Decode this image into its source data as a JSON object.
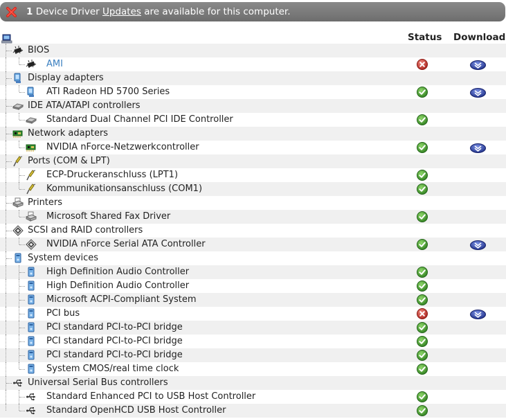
{
  "banner": {
    "count": "1",
    "pre_text": "Device Driver",
    "link_text": "Updates",
    "post_text": "are available for this computer."
  },
  "columns": {
    "status": "Status",
    "download": "Download"
  },
  "tree": [
    {
      "label": "BIOS",
      "level": 0,
      "icon": "chip-icon",
      "status": null,
      "download": false
    },
    {
      "label": "AMI",
      "level": 1,
      "icon": "chip-icon",
      "status": "error",
      "download": true,
      "link": true
    },
    {
      "label": "Display adapters",
      "level": 0,
      "icon": "monitor-icon",
      "status": null,
      "download": false
    },
    {
      "label": "ATI Radeon HD 5700 Series",
      "level": 1,
      "icon": "monitor-icon",
      "status": "ok",
      "download": true
    },
    {
      "label": "IDE ATA/ATAPI controllers",
      "level": 0,
      "icon": "drive-icon",
      "status": null,
      "download": false
    },
    {
      "label": "Standard Dual Channel PCI IDE Controller",
      "level": 1,
      "icon": "drive-icon",
      "status": "ok",
      "download": false
    },
    {
      "label": "Network adapters",
      "level": 0,
      "icon": "network-card-icon",
      "status": null,
      "download": false
    },
    {
      "label": "NVIDIA nForce-Netzwerkcontroller",
      "level": 1,
      "icon": "network-card-icon",
      "status": "ok",
      "download": true
    },
    {
      "label": "Ports (COM & LPT)",
      "level": 0,
      "icon": "port-icon",
      "status": null,
      "download": false
    },
    {
      "label": "ECP-Druckeranschluss (LPT1)",
      "level": 1,
      "icon": "port-icon",
      "status": "ok",
      "download": false
    },
    {
      "label": "Kommunikationsanschluss (COM1)",
      "level": 1,
      "icon": "port-icon",
      "status": "ok",
      "download": false
    },
    {
      "label": "Printers",
      "level": 0,
      "icon": "printer-icon",
      "status": null,
      "download": false
    },
    {
      "label": "Microsoft Shared Fax Driver",
      "level": 1,
      "icon": "printer-icon",
      "status": "ok",
      "download": false
    },
    {
      "label": "SCSI and RAID controllers",
      "level": 0,
      "icon": "scsi-icon",
      "status": null,
      "download": false
    },
    {
      "label": "NVIDIA nForce Serial ATA Controller",
      "level": 1,
      "icon": "scsi-icon",
      "status": "ok",
      "download": true
    },
    {
      "label": "System devices",
      "level": 0,
      "icon": "system-device-icon",
      "status": null,
      "download": false
    },
    {
      "label": "High Definition Audio Controller",
      "level": 1,
      "icon": "system-device-icon",
      "status": "ok",
      "download": false
    },
    {
      "label": "High Definition Audio Controller",
      "level": 1,
      "icon": "system-device-icon",
      "status": "ok",
      "download": false
    },
    {
      "label": "Microsoft ACPI-Compliant System",
      "level": 1,
      "icon": "system-device-icon",
      "status": "ok",
      "download": false
    },
    {
      "label": "PCI bus",
      "level": 1,
      "icon": "system-device-icon",
      "status": "error",
      "download": true
    },
    {
      "label": "PCI standard PCI-to-PCI bridge",
      "level": 1,
      "icon": "system-device-icon",
      "status": "ok",
      "download": false
    },
    {
      "label": "PCI standard PCI-to-PCI bridge",
      "level": 1,
      "icon": "system-device-icon",
      "status": "ok",
      "download": false
    },
    {
      "label": "PCI standard PCI-to-PCI bridge",
      "level": 1,
      "icon": "system-device-icon",
      "status": "ok",
      "download": false
    },
    {
      "label": "System CMOS/real time clock",
      "level": 1,
      "icon": "system-device-icon",
      "status": "ok",
      "download": false
    },
    {
      "label": "Universal Serial Bus controllers",
      "level": 0,
      "icon": "usb-icon",
      "status": null,
      "download": false
    },
    {
      "label": "Standard Enhanced PCI to USB Host Controller",
      "level": 1,
      "icon": "usb-icon",
      "status": "ok",
      "download": false
    },
    {
      "label": "Standard OpenHCD USB Host Controller",
      "level": 1,
      "icon": "usb-icon",
      "status": "ok",
      "download": false
    }
  ],
  "colors": {
    "banner": "#7a7a7a",
    "ok": "#3f9a2c",
    "error": "#c0302a",
    "download": "#2a3d9e",
    "link": "#3a7fc0",
    "shade": "#f0f0f0"
  }
}
